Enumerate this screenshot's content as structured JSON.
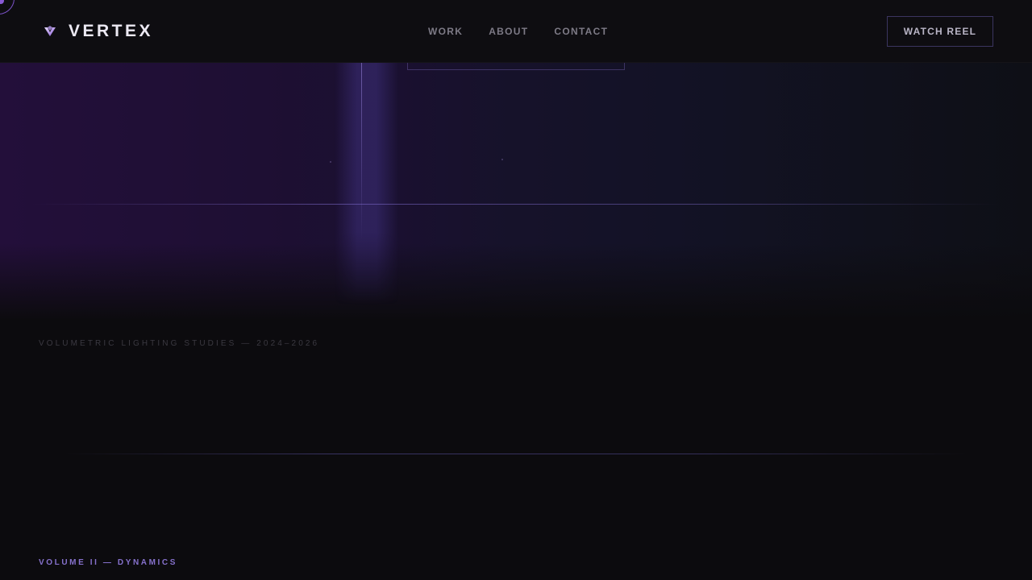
{
  "brand": {
    "name": "VERTEX",
    "icon": "vertex-logo-icon"
  },
  "nav": {
    "items": [
      {
        "label": "WORK"
      },
      {
        "label": "ABOUT"
      },
      {
        "label": "CONTACT"
      }
    ]
  },
  "header": {
    "cta_label": "WATCH REEL"
  },
  "hero": {
    "caption": "VOLUMETRIC LIGHTING STUDIES — 2024–2026"
  },
  "section": {
    "volume_label": "VOLUME II — DYNAMICS"
  },
  "colors": {
    "accent": "#8671cc",
    "accent_bright": "#8a5ad6",
    "background": "#0c0b0e",
    "text_primary": "#ece9f3",
    "text_muted": "#7d7a86"
  }
}
